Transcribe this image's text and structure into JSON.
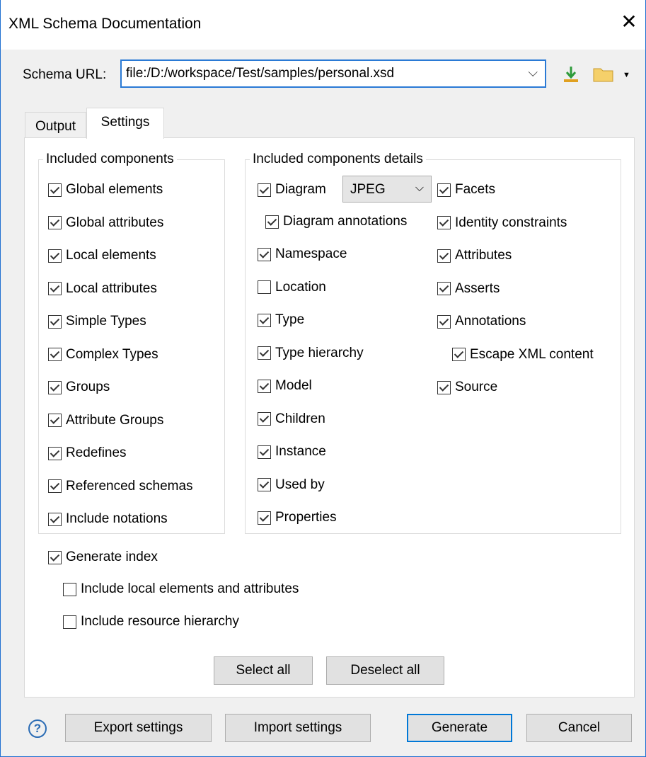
{
  "window": {
    "title": "XML Schema Documentation"
  },
  "url": {
    "label": "Schema URL:",
    "value": "file:/D:/workspace/Test/samples/personal.xsd"
  },
  "tabs": [
    "Output",
    "Settings"
  ],
  "included_components": {
    "legend": "Included components",
    "items": [
      {
        "label": "Global elements",
        "checked": true
      },
      {
        "label": "Global attributes",
        "checked": true
      },
      {
        "label": "Local elements",
        "checked": true
      },
      {
        "label": "Local attributes",
        "checked": true
      },
      {
        "label": "Simple Types",
        "checked": true
      },
      {
        "label": "Complex Types",
        "checked": true
      },
      {
        "label": "Groups",
        "checked": true
      },
      {
        "label": "Attribute Groups",
        "checked": true
      },
      {
        "label": "Redefines",
        "checked": true
      },
      {
        "label": "Referenced schemas",
        "checked": true
      },
      {
        "label": "Include notations",
        "checked": true
      }
    ]
  },
  "details": {
    "legend": "Included components details",
    "diagram_label": "Diagram",
    "diagram_format": "JPEG",
    "diagram_annotations": "Diagram annotations",
    "col1": [
      {
        "label": "Namespace",
        "checked": true
      },
      {
        "label": "Location",
        "checked": false
      },
      {
        "label": "Type",
        "checked": true
      },
      {
        "label": "Type hierarchy",
        "checked": true
      },
      {
        "label": "Model",
        "checked": true
      },
      {
        "label": "Children",
        "checked": true
      },
      {
        "label": "Instance",
        "checked": true
      },
      {
        "label": "Used by",
        "checked": true
      },
      {
        "label": "Properties",
        "checked": true
      }
    ],
    "col2": [
      {
        "label": "Facets",
        "checked": true
      },
      {
        "label": "Identity constraints",
        "checked": true
      },
      {
        "label": "Attributes",
        "checked": true
      },
      {
        "label": "Asserts",
        "checked": true
      },
      {
        "label": "Annotations",
        "checked": true
      },
      {
        "label": "Escape XML content",
        "checked": true
      },
      {
        "label": "Source",
        "checked": true
      }
    ]
  },
  "index": {
    "generate": "Generate index",
    "local": "Include local elements and attributes",
    "hierarchy": "Include resource hierarchy"
  },
  "buttons": {
    "select_all": "Select all",
    "deselect_all": "Deselect all",
    "export": "Export settings",
    "import": "Import settings",
    "generate": "Generate",
    "cancel": "Cancel"
  }
}
